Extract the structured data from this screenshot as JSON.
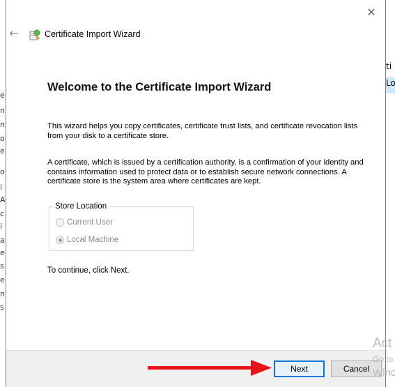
{
  "dialog": {
    "title": "Certificate Import Wizard",
    "close_glyph": "✕",
    "back_glyph": "←"
  },
  "content": {
    "heading": "Welcome to the Certificate Import Wizard",
    "paragraph1": "This wizard helps you copy certificates, certificate trust lists, and certificate revocation lists from your disk to a certificate store.",
    "paragraph2": "A certificate, which is issued by a certification authority, is a confirmation of your identity and contains information used to protect data or to establish secure network connections. A certificate store is the system area where certificates are kept.",
    "store_location": {
      "legend": "Store Location",
      "options": [
        {
          "label": "Current User",
          "checked": false
        },
        {
          "label": "Local Machine",
          "checked": true
        }
      ]
    },
    "continue_text": "To continue, click Next."
  },
  "buttons": {
    "next": "Next",
    "cancel": "Cancel"
  },
  "background": {
    "right_header_fragment": "ti",
    "right_row_fragment": "Lo",
    "left_fragments": [
      "e",
      "n",
      "n",
      "o",
      "e",
      "o",
      "i",
      "A",
      "c",
      "i",
      "a",
      "e",
      "s",
      "e",
      "n",
      "s"
    ]
  },
  "watermark": {
    "line1": "Act",
    "line2": "Go to",
    "line3": "Wind"
  },
  "colors": {
    "accent": "#0078d7",
    "annotation_arrow": "#e8141b"
  }
}
